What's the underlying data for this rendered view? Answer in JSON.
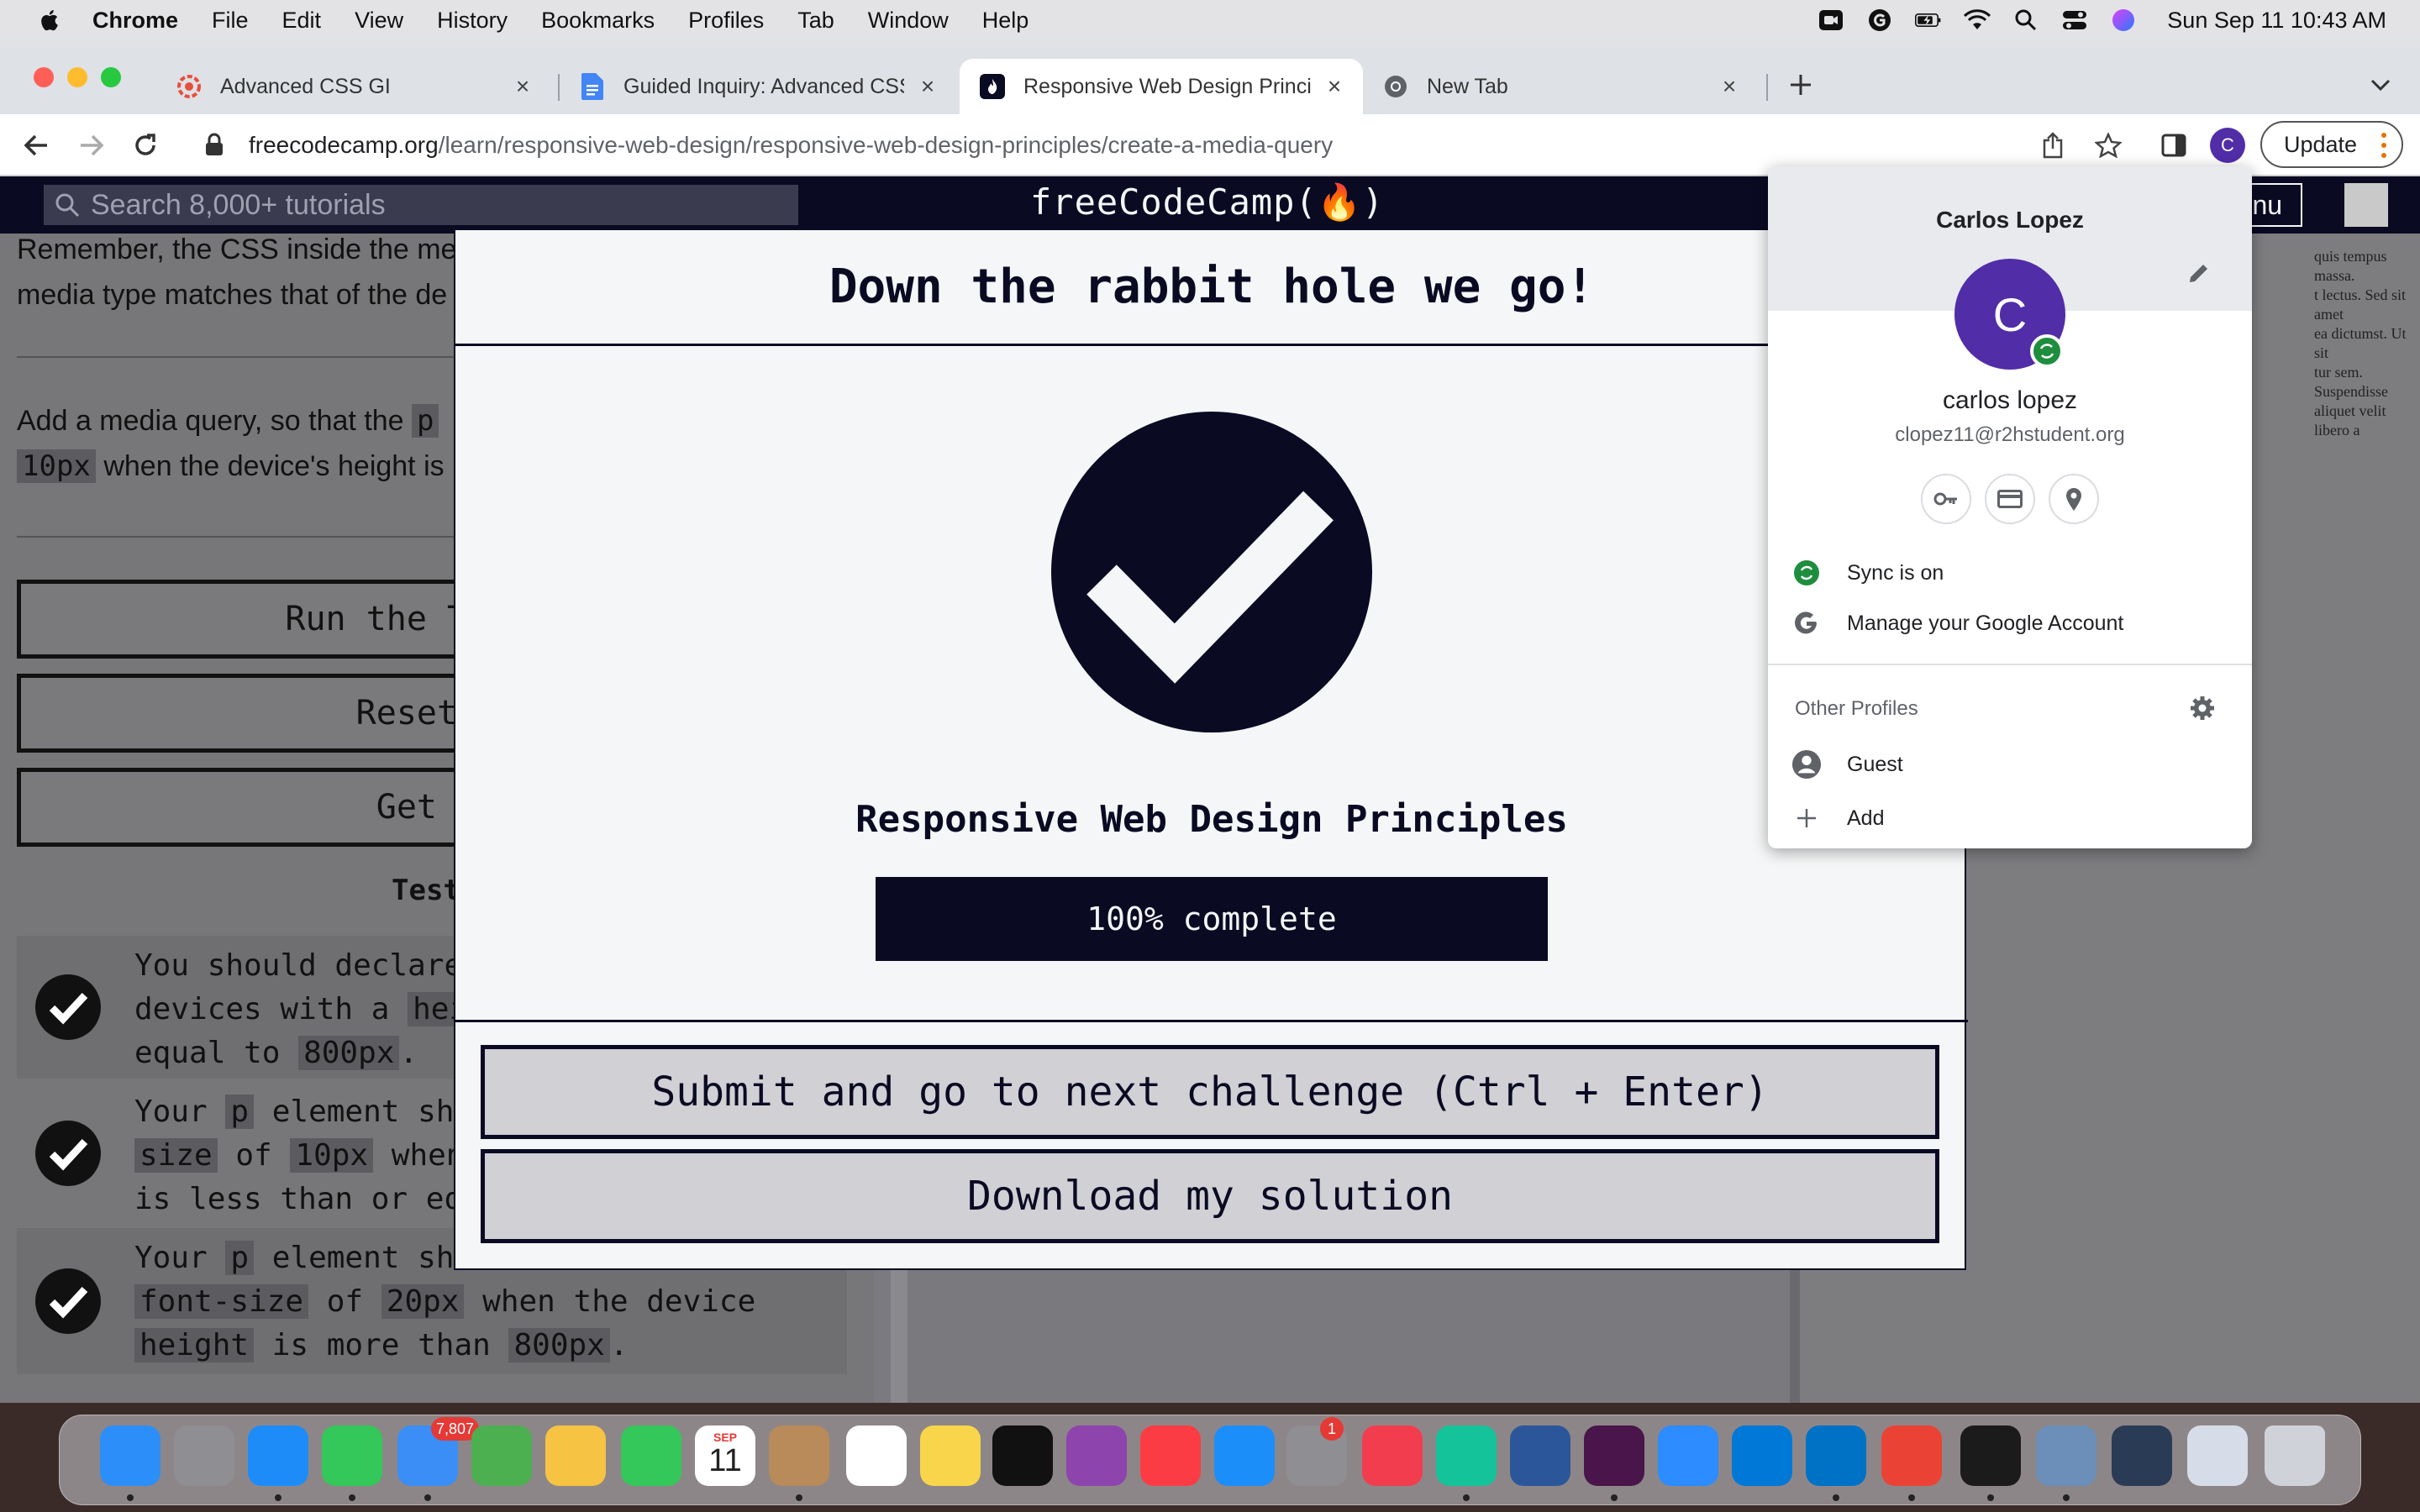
{
  "menubar": {
    "app": "Chrome",
    "items": [
      "File",
      "Edit",
      "View",
      "History",
      "Bookmarks",
      "Profiles",
      "Tab",
      "Window",
      "Help"
    ],
    "clock": "Sun Sep 11  10:43 AM"
  },
  "tabs": [
    {
      "label": "Advanced CSS GI",
      "favicon": "cpanel-icon",
      "color": "#e94e3b"
    },
    {
      "label": "Guided Inquiry: Advanced CSS",
      "favicon": "docs-icon",
      "color": "#4285f4"
    },
    {
      "label": "Responsive Web Design Princip",
      "favicon": "freecodecamp-icon",
      "color": "#0a0a23"
    },
    {
      "label": "New Tab",
      "favicon": "chrome-icon",
      "color": "#5f6368"
    }
  ],
  "toolbar": {
    "url_host": "freecodecamp.org",
    "url_path": "/learn/responsive-web-design/responsive-web-design-principles/create-a-media-query",
    "update_label": "Update",
    "profile_initial": "C"
  },
  "fcc": {
    "search_placeholder": "Search 8,000+ tutorials",
    "logo": "freeCodeCamp(🔥)",
    "menu_label": "Menu"
  },
  "left": {
    "para1a": "Remember, the CSS inside the me",
    "para1b": "media type matches that of the de",
    "para2a": "Add a media query, so that the ",
    "para2_code1": "p",
    "para2b_code": "10px",
    "para2b": " when the device's height is",
    "btn_run": "Run the Tests (",
    "btn_reset": "Reset Al",
    "btn_help": "Get He",
    "tests_heading": "Test",
    "tests": [
      {
        "line1": "You should declare",
        "line2a": "devices with a ",
        "line2_code": "hei",
        "line3a": "equal to ",
        "line3_code": "800px",
        "line3b": "."
      },
      {
        "line1a": "Your ",
        "line1_code": "p",
        "line1b": " element sh",
        "line2_code": "size",
        "line2a": " of ",
        "line2_code2": "10px",
        "line2b": " when",
        "line3": "is less than or eq"
      },
      {
        "line1a": "Your ",
        "line1_code": "p",
        "line1b": " element should have an initial",
        "line2_code": "font-size",
        "line2a": " of ",
        "line2_code2": "20px",
        "line2b": " when the device",
        "line3_code": "height",
        "line3a": " is more than ",
        "line3_code2": "800px",
        "line3b": "."
      }
    ]
  },
  "modal": {
    "title": "Down the rabbit hole we go!",
    "cert_name": "Responsive Web Design Principles",
    "progress_percent": 100,
    "progress_text": "100% complete",
    "submit_label": "Submit and go to next challenge (Ctrl + Enter)",
    "download_label": "Download my solution"
  },
  "profile_popup": {
    "title": "Carlos Lopez",
    "avatar_initial": "C",
    "name": "carlos lopez",
    "email": "clopez11@r2hstudent.org",
    "sync_label": "Sync is on",
    "manage_label": "Manage your Google Account",
    "other_profiles": "Other Profiles",
    "guest_label": "Guest",
    "add_label": "Add"
  },
  "right_panel_text": [
    "quis tempus massa.",
    "t lectus. Sed sit amet",
    "ea dictumst. Ut sit",
    "tur sem. Suspendisse",
    "aliquet velit libero a"
  ],
  "dock": {
    "mail_badge": "7,807",
    "calendar_month": "SEP",
    "calendar_day": "11",
    "settings_badge": "1",
    "apps": [
      "finder",
      "launchpad",
      "safari",
      "messages",
      "mail",
      "maps",
      "photos",
      "facetime",
      "calendar",
      "contacts",
      "reminders",
      "notes",
      "tv",
      "podcasts",
      "music",
      "app-store",
      "system-preferences",
      "news",
      "grammarly",
      "word",
      "slack",
      "zoom",
      "vscode",
      "outlook",
      "chrome",
      "terminal",
      "preview",
      "screenshot-1",
      "screenshot-2",
      "trash"
    ],
    "colors": [
      "#2c8ef8",
      "#8e8e93",
      "#1d8cf8",
      "#34c759",
      "#3a8ef6",
      "#4caf50",
      "#f6c343",
      "#34c759",
      "#ffffff",
      "#b98a5a",
      "#ffffff",
      "#f8d54a",
      "#111111",
      "#8e44ad",
      "#fc3c44",
      "#1c8ef9",
      "#8e8e93",
      "#f23d4f",
      "#15c39a",
      "#2b579a",
      "#4a154b",
      "#2d8cff",
      "#0078d7",
      "#0072c6",
      "#ea4335",
      "#1b1b1b",
      "#6b8fb8",
      "#2a3b55",
      "#d7dde8",
      "#cfd3d9"
    ]
  }
}
